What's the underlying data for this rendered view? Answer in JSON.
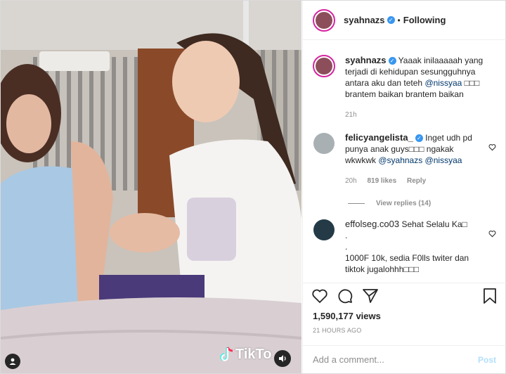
{
  "header": {
    "username": "syahnazs",
    "separator": "•",
    "following_label": "Following"
  },
  "caption": {
    "username": "syahnazs",
    "text": "Yaaak inilaaaaah yang terjadi di kehidupan sesungguhnya antara aku dan teteh",
    "mention": "@nissyaa",
    "text_after": "□□□ brantem baikan brantem baikan",
    "time": "21h"
  },
  "comments": [
    {
      "username": "felicyangelista_",
      "text": "Inget udh pd punya anak guys□□□ ngakak wkwkwk",
      "mentions": "@syahnazs @nissyaa",
      "time": "20h",
      "likes": "819 likes",
      "reply_label": "Reply",
      "view_replies": "View replies (14)"
    },
    {
      "username": "effolseg.co03",
      "text_line1": "Sehat Selalu Ka□",
      "text_line2": ".",
      "text_line3": ".",
      "text_line4": "1000F 10k, sedia F0lls twiter dan tiktok jugalohhh□□□"
    }
  ],
  "stats": {
    "views": "1,590,177 views",
    "time_ago": "21 HOURS AGO"
  },
  "add_comment": {
    "placeholder": "Add a comment...",
    "post_label": "Post"
  },
  "media": {
    "watermark": "TikTo"
  },
  "colors": {
    "link": "#00376b",
    "verified": "#3897f0",
    "story_ring": "#d6249f",
    "post_disabled": "#b2dffc"
  }
}
